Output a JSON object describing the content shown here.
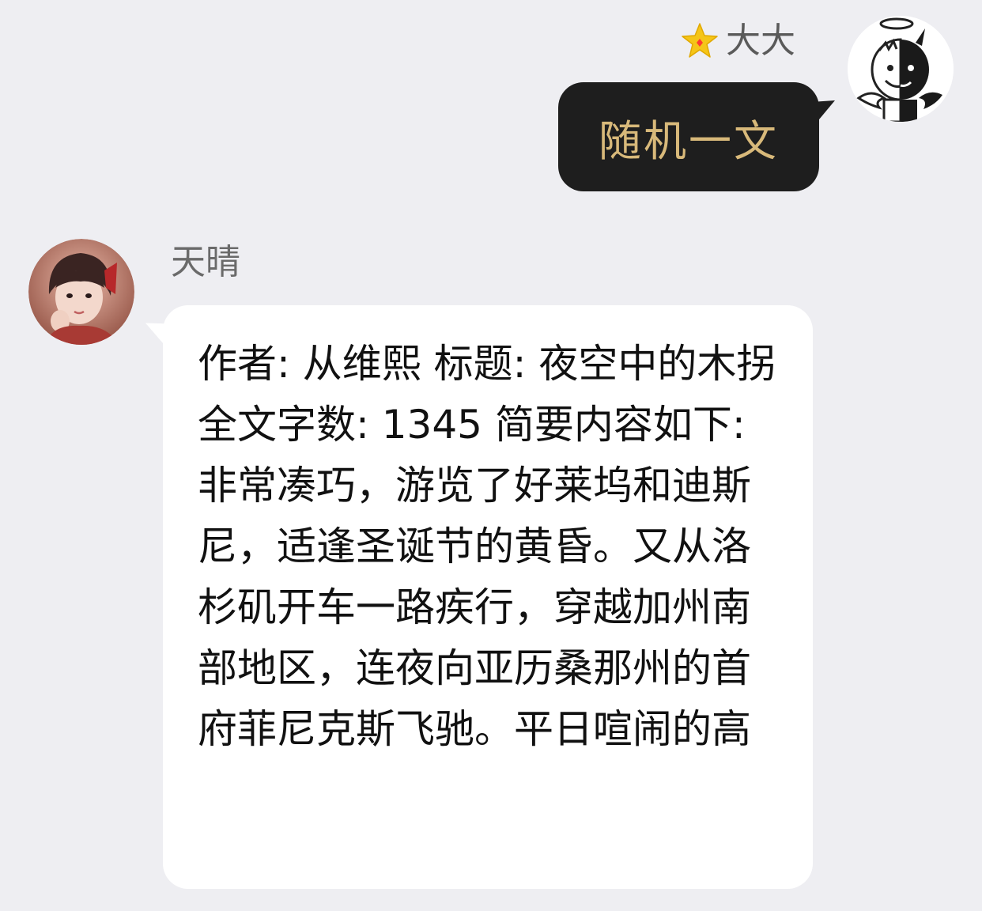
{
  "chat": {
    "outgoing": {
      "sender_name": "大大",
      "badge_icon": "star-icon",
      "message": "随机一文",
      "colors": {
        "bubble": "#1e1e1e",
        "text": "#d8b97a",
        "badge": "#f5c518"
      }
    },
    "incoming": {
      "sender_name": "天晴",
      "message": "作者: 从维熙 标题: 夜空中的木拐 全文字数: 1345 简要内容如下: 非常凑巧，游览了好莱坞和迪斯尼，适逢圣诞节的黄昏。又从洛杉矶开车一路疾行，穿越加州南部地区，连夜向亚历桑那州的首府菲尼克斯飞驰。平日喧闹的高",
      "colors": {
        "bubble": "#ffffff",
        "text": "#111111"
      }
    },
    "background": "#eeeef2"
  }
}
